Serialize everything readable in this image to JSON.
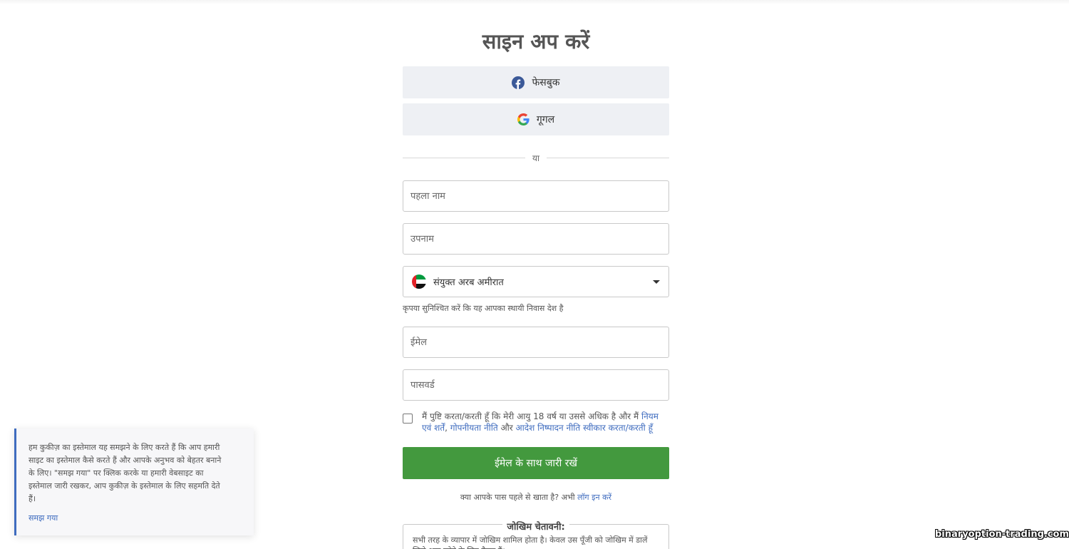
{
  "page": {
    "title": "साइन अप करें"
  },
  "social": {
    "facebook_label": "फेसबुक",
    "google_label": "गूगल"
  },
  "divider_text": "या",
  "fields": {
    "first_name_placeholder": "पहला नाम",
    "last_name_placeholder": "उपनाम",
    "country_value": "संयुक्त अरब अमीरात",
    "country_hint": "कृपया सुनिश्चित करें कि यह आपका स्थायी निवास देश है",
    "email_placeholder": "ईमेल",
    "password_placeholder": "पासवर्ड"
  },
  "agreement": {
    "prefix": "मैं पुष्टि करता/करती हूँ कि मेरी आयु 18 वर्ष या उससे अधिक है और मैं",
    "terms_link": "नियम एवं शर्तें",
    "comma": ",",
    "privacy_link": "गोपनीयता नीति",
    "and": "और",
    "order_link": "आदेश निष्पादन नीति",
    "accept_link": "स्वीकार करता/करती हूँ"
  },
  "submit_label": "ईमेल के साथ जारी रखें",
  "login": {
    "question": "क्या आपके पास पहले से खाता है? अभी",
    "link": "लॉग इन करें"
  },
  "risk": {
    "title": "जोखिम चेतावनी:",
    "text": "सभी तरह के व्यापार में जोखिम शामिल होता है। केवल उस पूँजी को जोखिम में डालें जिसे आप खोने के लिए तैयार हैं।"
  },
  "cookie": {
    "text": "हम कुकीज़ का इस्तेमाल यह समझने के लिए करते हैं कि आप हमारी साइट का इस्तेमाल कैसे करते हैं और आपके अनुभव को बेहतर बनाने के लिए। \"समझ गया\" पर क्लिक करके या हमारी वेबसाइट का इस्तेमाल जारी रखकर, आप कुकीज़ के इस्तेमाल के लिए सहमति देते हैं।",
    "button": "समझ गया"
  },
  "watermark": "binaryoption-trading.com",
  "colors": {
    "accent_green": "#43993e",
    "link_blue": "#3f6cbf",
    "facebook_blue": "#3b5998"
  }
}
